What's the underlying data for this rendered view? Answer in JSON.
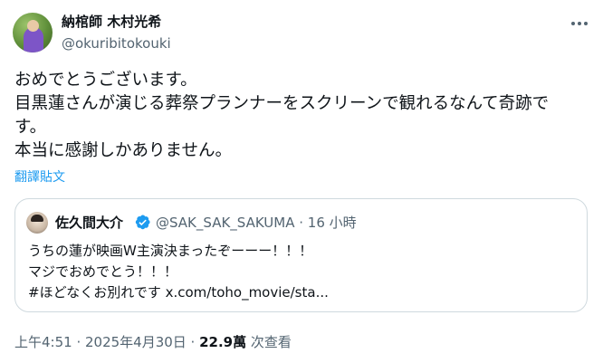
{
  "author": {
    "display_name": "納棺師 木村光希",
    "handle": "@okuribitokouki"
  },
  "tweet": {
    "lines": [
      "おめでとうございます。",
      "目黒蓮さんが演じる葬祭プランナーをスクリーンで観れるなんて奇跡で",
      "す。",
      "本当に感謝しかありません。"
    ],
    "translate_label": "翻譯貼文"
  },
  "quote": {
    "display_name": "佐久間大介",
    "verified": true,
    "meta": "@SAK_SAK_SAKUMA · 16 小時",
    "lines": [
      "うちの蓮が映画W主演決まったぞーーー！！！",
      "マジでおめでとう！！！",
      "#ほどなくお別れです x.com/toho_movie/sta..."
    ]
  },
  "footer": {
    "timestamp": "上午4:51 · 2025年4月30日 · ",
    "views_count": "22.9萬",
    "views_label": " 次查看"
  },
  "icons": {
    "more": "more-horizontal-icon",
    "verified": "verified-badge-icon"
  },
  "colors": {
    "link": "#1d9bf0",
    "secondary_text": "#536471",
    "border": "#cfd9de",
    "verified": "#1d9bf0"
  }
}
